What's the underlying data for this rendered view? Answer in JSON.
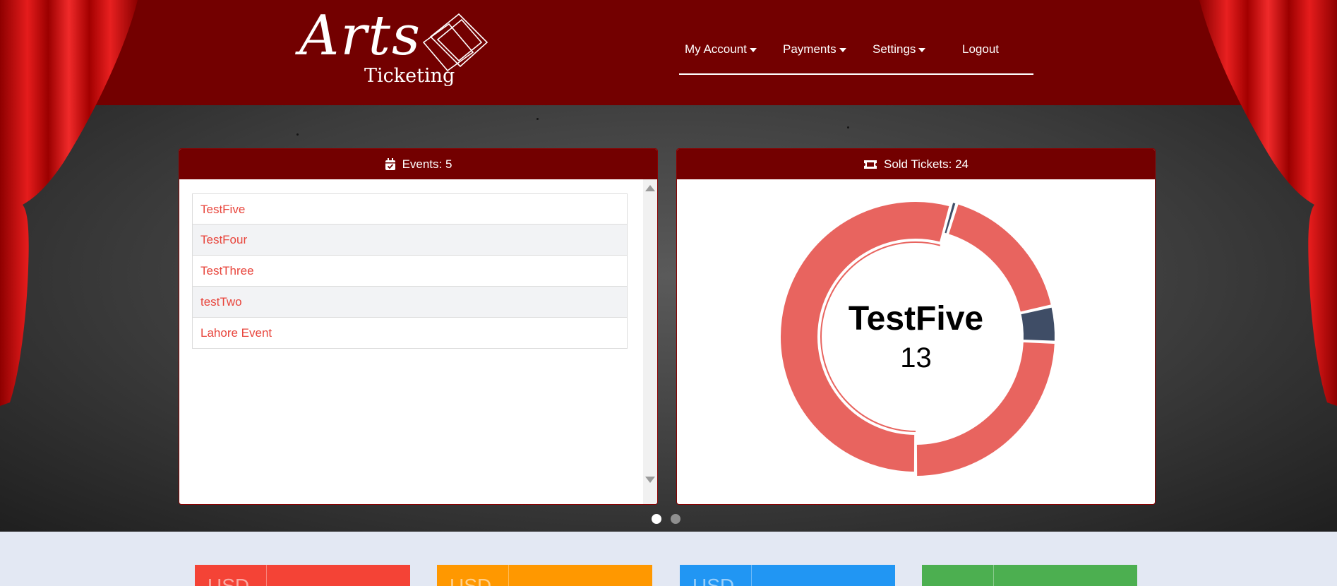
{
  "brand": {
    "logo_script": "Arts",
    "logo_sub": "Ticketing"
  },
  "nav": {
    "items": [
      {
        "label": "My Account",
        "dropdown": true
      },
      {
        "label": "Payments",
        "dropdown": true
      },
      {
        "label": "Settings",
        "dropdown": true
      },
      {
        "label": "Logout",
        "dropdown": false
      }
    ]
  },
  "events_card": {
    "title": "Events: 5",
    "icon": "calendar-check-icon",
    "events": [
      "TestFive",
      "TestFour",
      "TestThree",
      "testTwo",
      "Lahore Event"
    ]
  },
  "tickets_card": {
    "title": "Sold Tickets: 24",
    "icon": "ticket-icon",
    "center_title": "TestFive",
    "center_value": "13"
  },
  "chart_data": {
    "type": "pie",
    "title": "",
    "slices": [
      {
        "label": "TestFive",
        "value": 13,
        "color": "#e8645f"
      },
      {
        "label": "",
        "value": 0.15,
        "color": "#3f4d66"
      },
      {
        "label": "",
        "value": 4,
        "color": "#e8645f"
      },
      {
        "label": "",
        "value": 1,
        "color": "#3f4d66"
      },
      {
        "label": "",
        "value": 5.85,
        "color": "#e8645f"
      }
    ],
    "total": 24,
    "highlighted": "TestFive"
  },
  "carousel": {
    "pages": 2,
    "active": 0
  },
  "stat_tiles": [
    {
      "label": "USD",
      "color": "#f44336"
    },
    {
      "label": "USD",
      "color": "#ff9800"
    },
    {
      "label": "USD",
      "color": "#2196f3"
    },
    {
      "label": "",
      "color": "#4caf50"
    }
  ],
  "colors": {
    "header": "#730000",
    "event_link": "#e8453c",
    "bottom_bg": "#e3e8f3"
  }
}
